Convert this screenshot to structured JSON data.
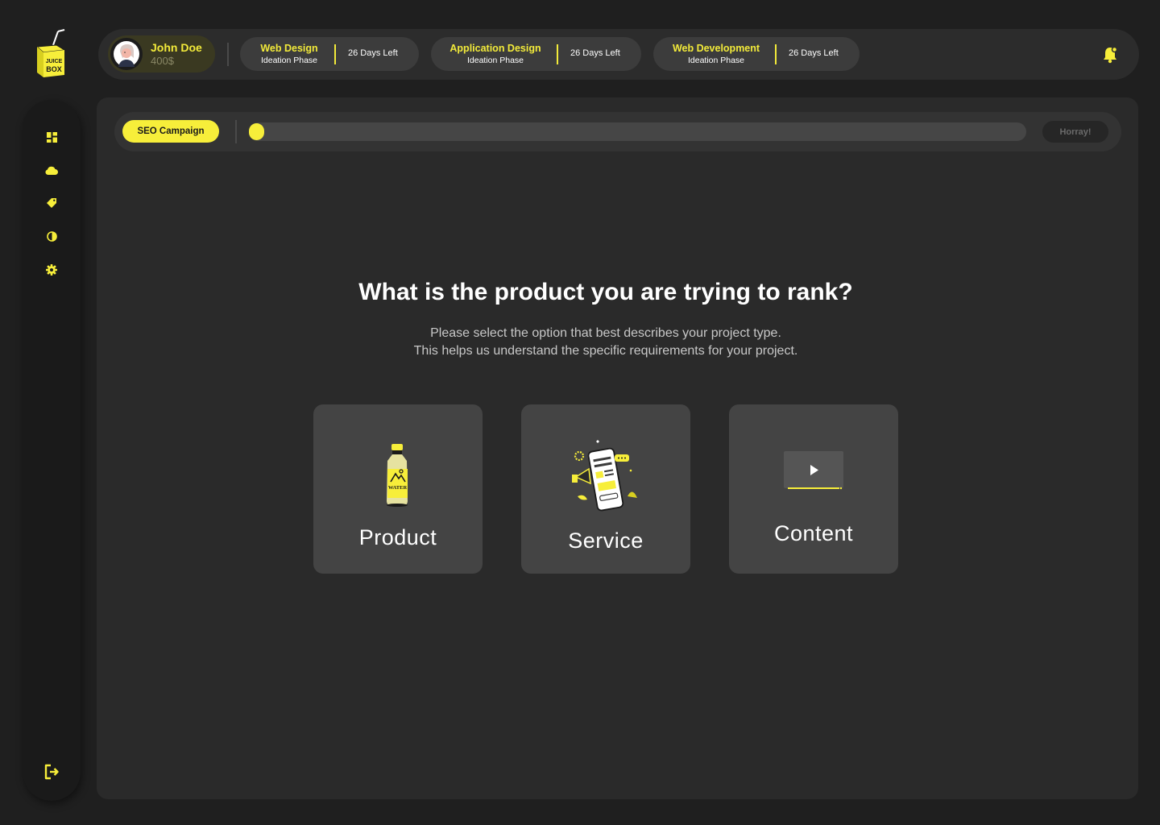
{
  "logo": {
    "text_top": "JUICE",
    "text_bottom": "BOX"
  },
  "sidebar": {
    "items": [
      {
        "icon": "dashboard-icon"
      },
      {
        "icon": "cloud-icon"
      },
      {
        "icon": "tag-icon"
      },
      {
        "icon": "contrast-icon"
      },
      {
        "icon": "gear-icon"
      }
    ],
    "logout_icon": "logout-icon"
  },
  "user": {
    "name": "John Doe",
    "balance": "400$"
  },
  "projects": [
    {
      "title": "Web Design",
      "phase": "Ideation Phase",
      "days_left": "26 Days Left"
    },
    {
      "title": "Application Design",
      "phase": "Ideation Phase",
      "days_left": "26 Days Left"
    },
    {
      "title": "Web Development",
      "phase": "Ideation Phase",
      "days_left": "26 Days Left"
    }
  ],
  "campaign": {
    "name": "SEO Campaign",
    "progress_percent": 2,
    "finish_label": "Horray!"
  },
  "main": {
    "question": "What is the product you are trying to rank?",
    "subtext_line1": "Please select the option that best describes your project type.",
    "subtext_line2": "This helps us understand the specific requirements for your project."
  },
  "options": [
    {
      "label": "Product",
      "illustration_text": "WATER"
    },
    {
      "label": "Service"
    },
    {
      "label": "Content"
    }
  ],
  "colors": {
    "accent": "#f7ee3a",
    "background": "#1f1f1f",
    "panel": "#2a2a2a",
    "card": "#444444"
  }
}
